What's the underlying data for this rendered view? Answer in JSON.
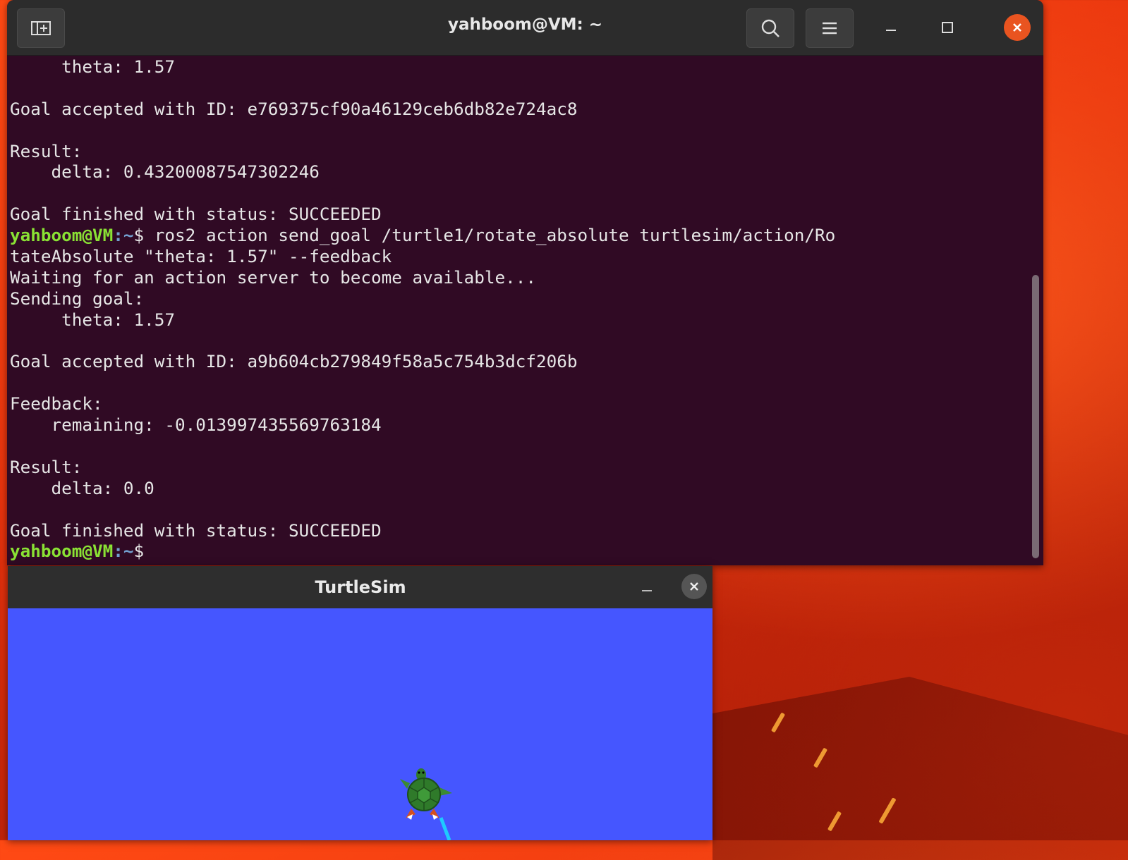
{
  "terminal": {
    "title": "yahboom@VM: ~",
    "lines": [
      {
        "text": "     theta: 1.57"
      },
      {
        "text": ""
      },
      {
        "text": "Goal accepted with ID: e769375cf90a46129ceb6db82e724ac8"
      },
      {
        "text": ""
      },
      {
        "text": "Result:"
      },
      {
        "text": "    delta: 0.43200087547302246"
      },
      {
        "text": ""
      },
      {
        "text": "Goal finished with status: SUCCEEDED"
      },
      {
        "prompt_user": "yahboom@VM",
        "prompt_path": ":~",
        "text": "$ ros2 action send_goal /turtle1/rotate_absolute turtlesim/action/Ro"
      },
      {
        "text": "tateAbsolute \"theta: 1.57\" --feedback"
      },
      {
        "text": "Waiting for an action server to become available..."
      },
      {
        "text": "Sending goal:"
      },
      {
        "text": "     theta: 1.57"
      },
      {
        "text": ""
      },
      {
        "text": "Goal accepted with ID: a9b604cb279849f58a5c754b3dcf206b"
      },
      {
        "text": ""
      },
      {
        "text": "Feedback:"
      },
      {
        "text": "    remaining: -0.013997435569763184"
      },
      {
        "text": ""
      },
      {
        "text": "Result:"
      },
      {
        "text": "    delta: 0.0"
      },
      {
        "text": ""
      },
      {
        "text": "Goal finished with status: SUCCEEDED"
      },
      {
        "prompt_user": "yahboom@VM",
        "prompt_path": ":~",
        "text": "$ "
      }
    ],
    "icons": {
      "new_tab": "new-tab-icon",
      "search": "search-icon",
      "menu": "hamburger-menu-icon",
      "minimize": "minimize-icon",
      "maximize": "maximize-icon",
      "close": "close-icon"
    },
    "colors": {
      "background": "#300a24",
      "prompt_user": "#8ae234",
      "prompt_path": "#729fcf",
      "close_button": "#e95420"
    }
  },
  "turtlesim": {
    "title": "TurtleSim",
    "colors": {
      "canvas": "#4556ff"
    }
  }
}
